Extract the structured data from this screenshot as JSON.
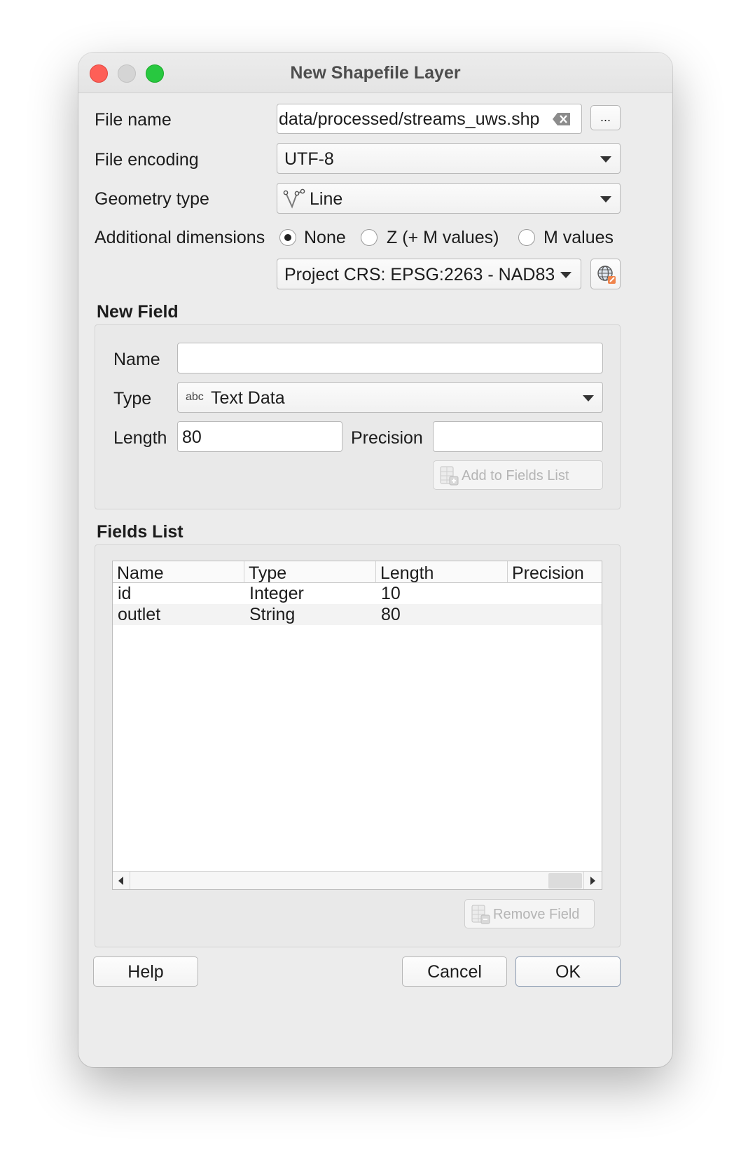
{
  "window": {
    "title": "New Shapefile Layer"
  },
  "form": {
    "file_name_label": "File name",
    "file_name_value": "data/processed/streams_uws.shp",
    "browse_label": "...",
    "file_encoding_label": "File encoding",
    "file_encoding_value": "UTF-8",
    "geometry_type_label": "Geometry type",
    "geometry_type_value": "Line",
    "additional_dimensions_label": "Additional dimensions",
    "dimension_options": [
      "None",
      "Z (+ M values)",
      "M values"
    ],
    "selected_dimension": "None",
    "crs_value": "Project CRS: EPSG:2263 - NAD83"
  },
  "new_field": {
    "section_title": "New Field",
    "name_label": "Name",
    "name_value": "",
    "type_label": "Type",
    "type_badge": "abc",
    "type_value": "Text Data",
    "length_label": "Length",
    "length_value": "80",
    "precision_label": "Precision",
    "precision_value": "",
    "add_button_label": "Add to Fields List"
  },
  "fields_list": {
    "section_title": "Fields List",
    "columns": [
      "Name",
      "Type",
      "Length",
      "Precision"
    ],
    "rows": [
      [
        "id",
        "Integer",
        "10",
        ""
      ],
      [
        "outlet",
        "String",
        "80",
        ""
      ]
    ],
    "remove_button_label": "Remove Field"
  },
  "footer": {
    "help_label": "Help",
    "cancel_label": "Cancel",
    "ok_label": "OK"
  },
  "colors": {
    "close": "#fe5f57",
    "minimize": "#d5d5d5",
    "maximize": "#28c840"
  }
}
